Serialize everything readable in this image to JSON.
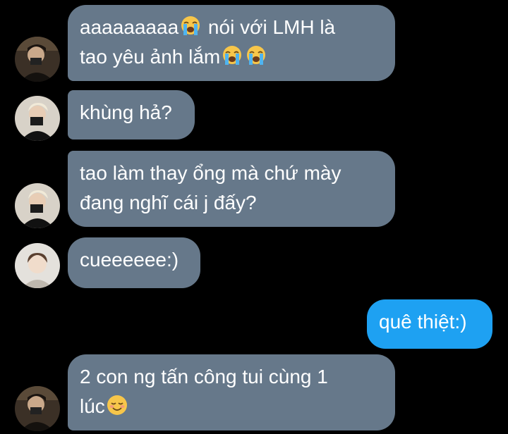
{
  "messages": [
    {
      "sender": "them",
      "line1_text": "aaaaaaaaa",
      "line1_emoji": "loudly-crying-face-emoji",
      "line1_after": " nói với LMH là",
      "line2_text": "tao yêu ảnh lắm",
      "line2_emojis": [
        "loudly-crying-face-emoji",
        "loudly-crying-face-emoji"
      ],
      "avatar": "user-avatar-dark-photo"
    },
    {
      "sender": "them",
      "text": "khùng hả?",
      "avatar": "user-avatar-blond-photo"
    },
    {
      "sender": "them",
      "line1": "tao làm thay ổng mà chứ mày",
      "line2": "đang nghĩ cái j đấy?",
      "avatar": "user-avatar-blond-photo"
    },
    {
      "sender": "them",
      "text": "cueeeeee:)",
      "avatar": "user-avatar-light-photo"
    },
    {
      "sender": "me",
      "text": "quê thiệt:)"
    },
    {
      "sender": "them",
      "line1": "2 con ng tấn công tui cùng 1",
      "line2_text": "lúc",
      "line2_emoji": "smiling-face-emoji",
      "avatar": "user-avatar-dark-photo"
    }
  ],
  "colors": {
    "background": "#000000",
    "received_bubble": "#66788a",
    "sent_bubble": "#1ea1f2",
    "text": "#ffffff"
  }
}
